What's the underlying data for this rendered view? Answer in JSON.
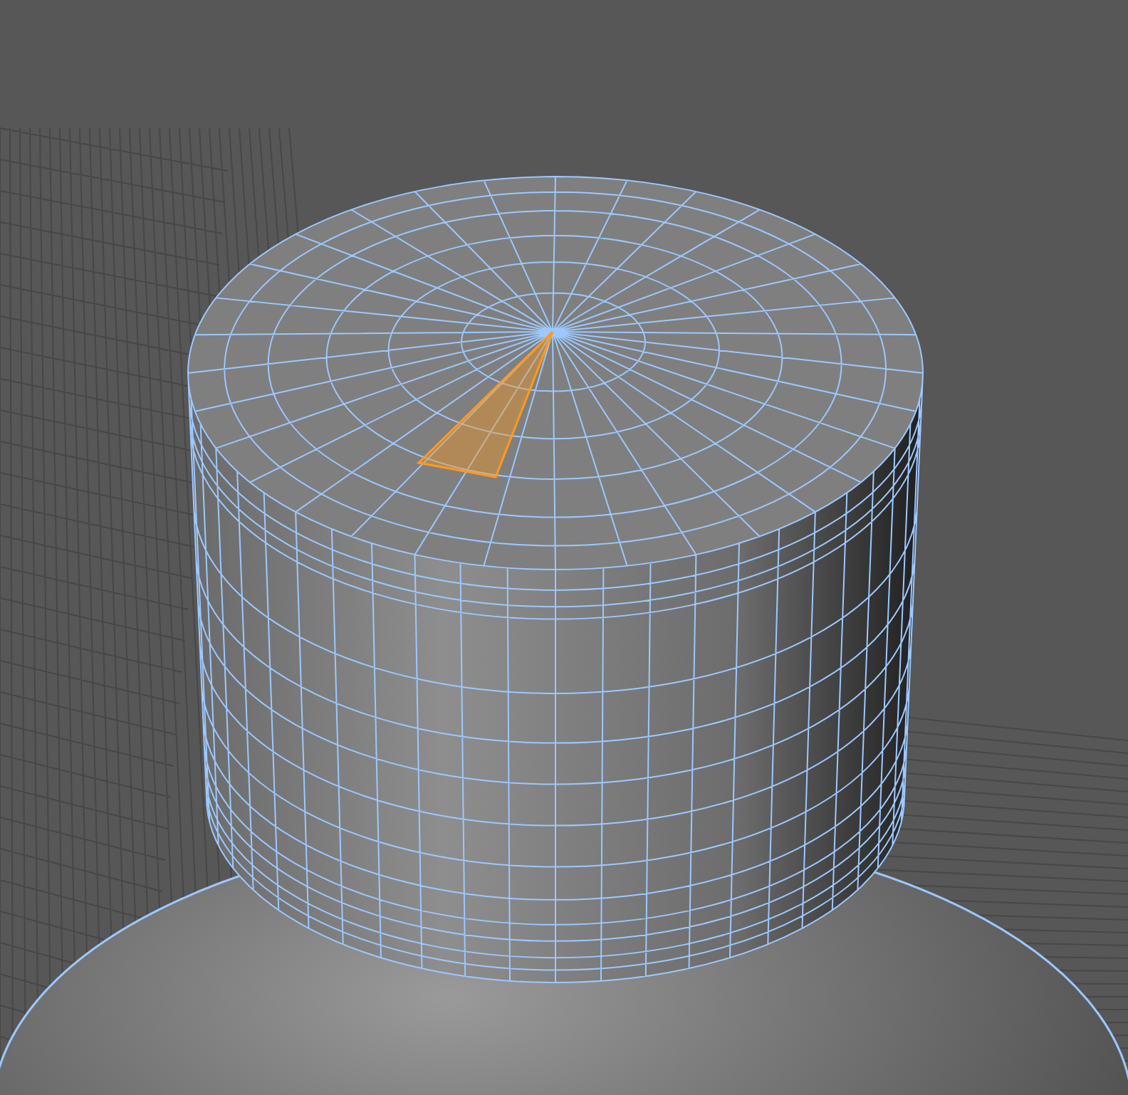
{
  "viewport": {
    "show_grid": true,
    "show_wireframe": true,
    "face_selected": true
  }
}
